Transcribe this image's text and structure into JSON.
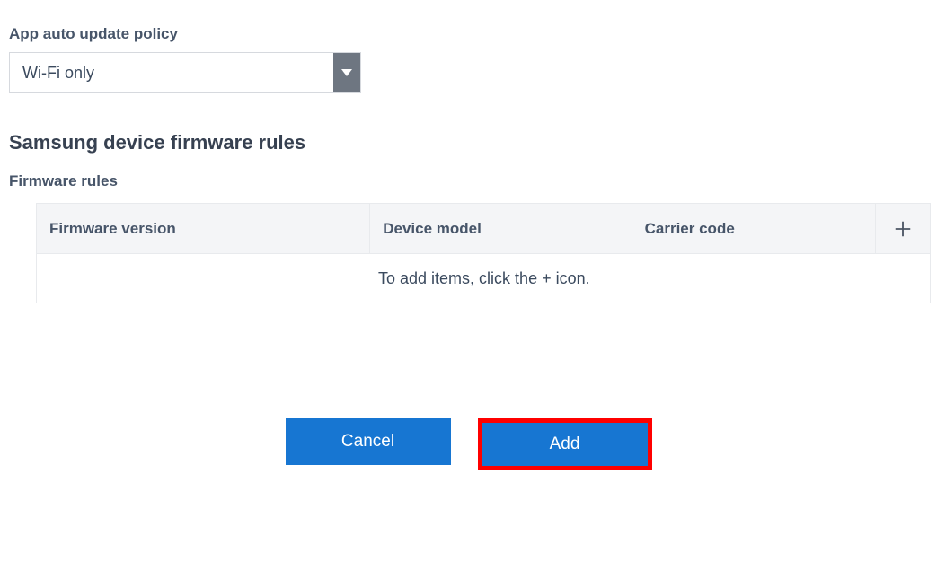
{
  "policy": {
    "label": "App auto update policy",
    "value": "Wi-Fi only"
  },
  "section": {
    "heading": "Samsung device firmware rules",
    "sub_label": "Firmware rules"
  },
  "table": {
    "headers": {
      "firmware_version": "Firmware version",
      "device_model": "Device model",
      "carrier_code": "Carrier code"
    },
    "empty_message": "To add items, click the + icon."
  },
  "buttons": {
    "cancel": "Cancel",
    "add": "Add"
  }
}
